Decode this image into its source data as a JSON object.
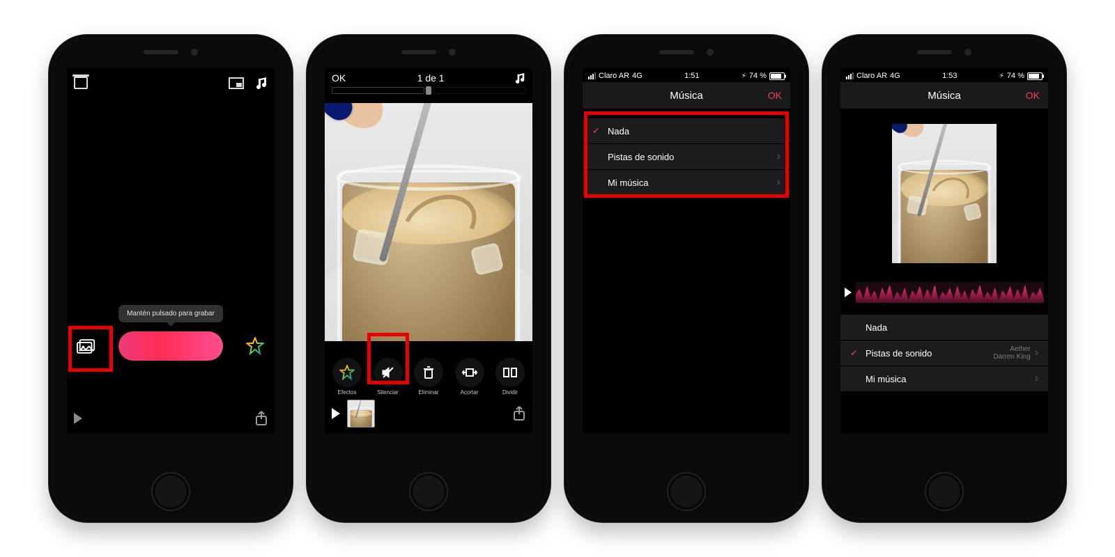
{
  "phone1": {
    "tooltip": "Mantén pulsado para grabar"
  },
  "phone2": {
    "ok": "OK",
    "counter": "1 de 1",
    "tools": {
      "efectos": "Efectos",
      "silenciar": "Silenciar",
      "eliminar": "Eliminar",
      "acortar": "Acortar",
      "dividir": "Dividir"
    }
  },
  "phone3": {
    "status": {
      "carrier": "Claro AR",
      "net": "4G",
      "time": "1:51",
      "battery": "74 %"
    },
    "nav": {
      "title": "Música",
      "ok": "OK"
    },
    "rows": {
      "nada": "Nada",
      "pistas": "Pistas de sonido",
      "mimusica": "Mi música"
    }
  },
  "phone4": {
    "status": {
      "carrier": "Claro AR",
      "net": "4G",
      "time": "1:53",
      "battery": "74 %"
    },
    "nav": {
      "title": "Música",
      "ok": "OK"
    },
    "rows": {
      "nada": "Nada",
      "pistas": "Pistas de sonido",
      "pistas_sub_top": "Aether",
      "pistas_sub_bot": "Darren King",
      "mimusica": "Mi música"
    }
  }
}
